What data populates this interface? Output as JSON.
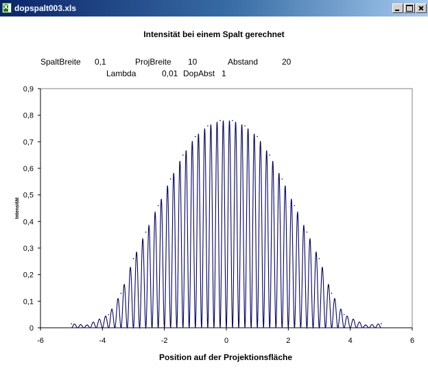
{
  "window": {
    "title": "dopspalt003.xls",
    "icon": "excel-icon",
    "controls": [
      "minimize-icon",
      "maximize-icon",
      "close-icon"
    ],
    "titlebar_color": "#0a246a"
  },
  "parameters": {
    "row1": [
      {
        "label": "SpaltBreite",
        "value": "0,1"
      },
      {
        "label": "ProjBreite",
        "value": "10"
      },
      {
        "label": "Abstand",
        "value": "20"
      }
    ],
    "row2": [
      {
        "label": "Lambda",
        "value": "0,01"
      },
      {
        "label": "DopAbst",
        "value": "1"
      }
    ]
  },
  "chart_data": {
    "type": "line",
    "title": "Intensität bei einem Spalt gerechnet",
    "xlabel": "Position auf der Projektionsfläche",
    "ylabel": "Intensität",
    "xlim": [
      -6,
      6
    ],
    "ylim": [
      0,
      0.9
    ],
    "x_ticks": [
      "-6",
      "-4",
      "-2",
      "0",
      "2",
      "4",
      "6"
    ],
    "y_ticks": [
      "0",
      "0,1",
      "0,2",
      "0,3",
      "0,4",
      "0,5",
      "0,6",
      "0,7",
      "0,8",
      "0,9"
    ],
    "grid": false,
    "line_color": "#000066",
    "series": [
      {
        "x_range": [
          -5,
          5
        ],
        "fringe_spacing": 0.2,
        "peaks": [
          {
            "x": -0.2,
            "y": 0.78
          },
          {
            "x": 0.2,
            "y": 0.78
          },
          {
            "x": -0.6,
            "y": 0.76
          },
          {
            "x": 0.6,
            "y": 0.76
          },
          {
            "x": -1.0,
            "y": 0.72
          },
          {
            "x": 1.0,
            "y": 0.72
          },
          {
            "x": -1.4,
            "y": 0.65
          },
          {
            "x": 1.4,
            "y": 0.65
          },
          {
            "x": -1.8,
            "y": 0.56
          },
          {
            "x": 1.8,
            "y": 0.56
          },
          {
            "x": -2.2,
            "y": 0.46
          },
          {
            "x": 2.2,
            "y": 0.46
          },
          {
            "x": -2.6,
            "y": 0.36
          },
          {
            "x": 2.6,
            "y": 0.36
          },
          {
            "x": -3.0,
            "y": 0.26
          },
          {
            "x": 3.0,
            "y": 0.26
          },
          {
            "x": -3.4,
            "y": 0.13
          },
          {
            "x": 3.4,
            "y": 0.13
          },
          {
            "x": -3.8,
            "y": 0.05
          },
          {
            "x": 3.8,
            "y": 0.05
          },
          {
            "x": -4.5,
            "y": 0.01
          },
          {
            "x": 4.5,
            "y": 0.01
          },
          {
            "x": -5.0,
            "y": 0.015
          },
          {
            "x": 5.0,
            "y": 0.015
          }
        ]
      }
    ]
  }
}
